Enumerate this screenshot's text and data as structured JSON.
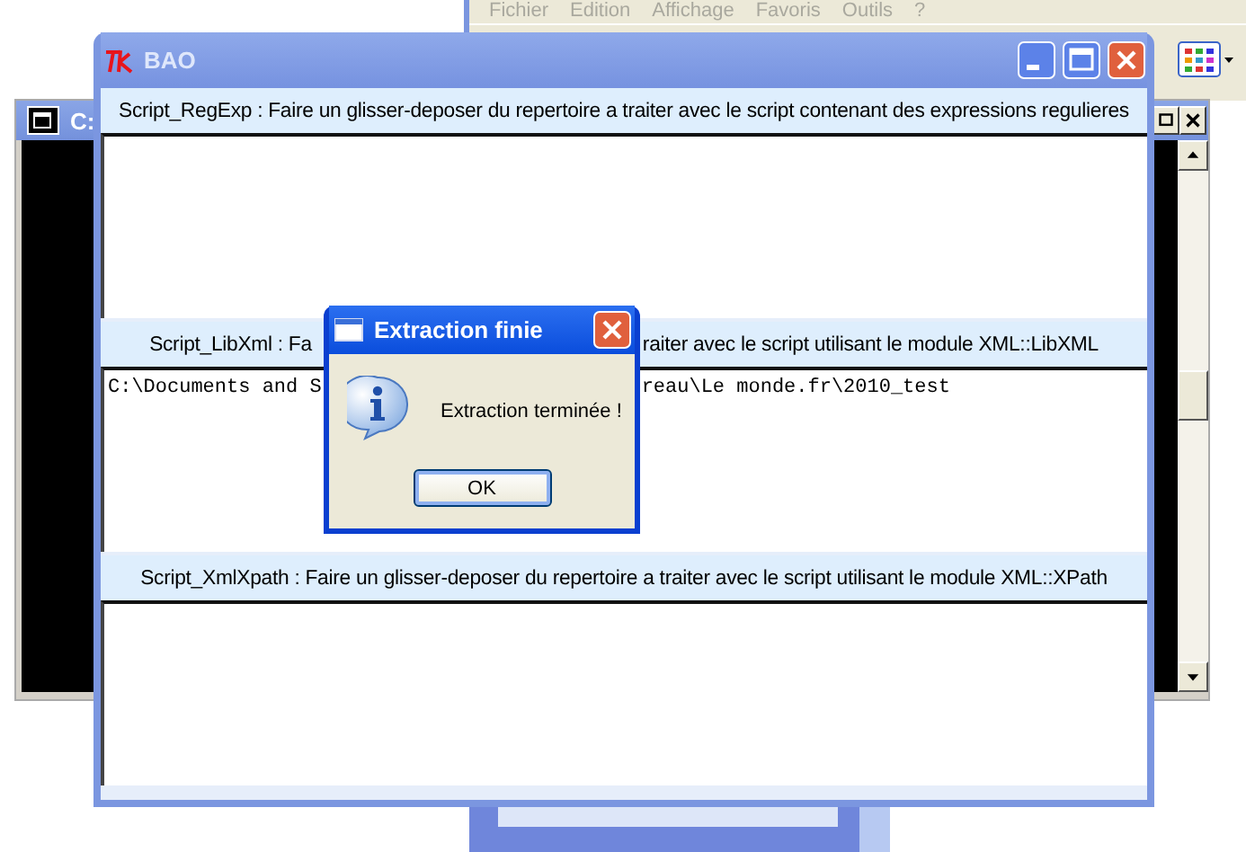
{
  "explorer_window": {
    "menu": [
      "Fichier",
      "Edition",
      "Affichage",
      "Favoris",
      "Outils",
      "?"
    ]
  },
  "console_window": {
    "title": "C:"
  },
  "main_window": {
    "title": "BAO",
    "sections": [
      {
        "label_parts": [
          "Script_RegExp : Faire un glisser-deposer du repertoire a traiter avec le script contenant des expressions regulieres"
        ]
      },
      {
        "label_parts": [
          "Script_LibXml : Fa",
          "raiter avec le script utilisant le module XML::LibXML"
        ],
        "output_parts": [
          "C:\\Documents and S",
          "reau\\Le monde.fr\\2010_test"
        ]
      },
      {
        "label_parts": [
          "Script_XmlXpath : Faire un glisser-deposer du repertoire a traiter avec le script utilisant le module XML::XPath"
        ]
      }
    ]
  },
  "dialog": {
    "title": "Extraction finie",
    "message": "Extraction terminée !",
    "buttons": [
      "OK"
    ]
  }
}
